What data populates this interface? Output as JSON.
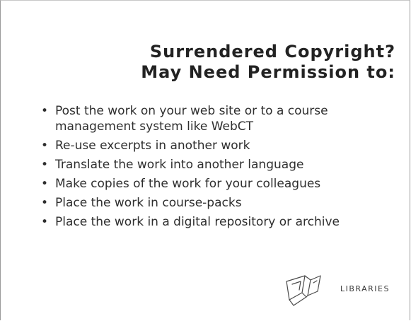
{
  "slide": {
    "title_line1": "Surrendered Copyright?",
    "title_line2": "May Need Permission to:",
    "bullets": [
      {
        "text": "Post the work on your web site or to a course management system like WebCT"
      },
      {
        "text": "Re-use excerpts in another work"
      },
      {
        "text": "Translate the work into another language"
      },
      {
        "text": "Make copies of the work for your colleagues"
      },
      {
        "text": "Place the work in course-packs"
      },
      {
        "text": "Place the work in a digital repository or archive"
      }
    ],
    "bullet_symbol": "•",
    "logo": {
      "icon": "libraries-logo-icon",
      "label": "LIBRARIES"
    }
  }
}
